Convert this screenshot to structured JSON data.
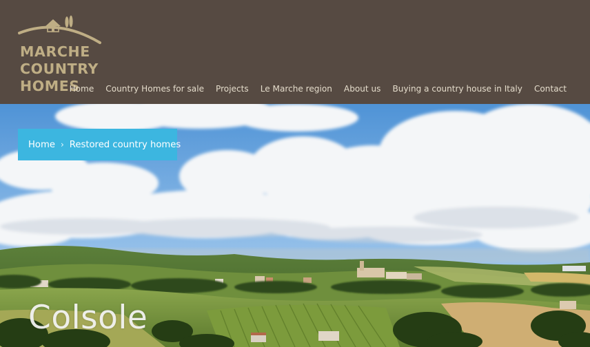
{
  "header": {
    "logo_lines": [
      "MARCHE",
      "COUNTRY",
      "HOMES"
    ]
  },
  "nav": {
    "items": [
      "Home",
      "Country Homes for sale",
      "Projects",
      "Le Marche region",
      "About us",
      "Buying a country house in Italy",
      "Contact"
    ]
  },
  "breadcrumb": {
    "home": "Home",
    "separator": "›",
    "current": "Restored country homes"
  },
  "hero": {
    "title": "Colsole"
  },
  "colors": {
    "header_bg": "#564a42",
    "logo_gold": "#bfae85",
    "nav_text": "#e4dccb",
    "breadcrumb_bg": "#3cb6e0"
  },
  "icons": {
    "logo_mark": "house-and-cypress-over-hill-icon",
    "breadcrumb_separator": "chevron-right-icon"
  }
}
